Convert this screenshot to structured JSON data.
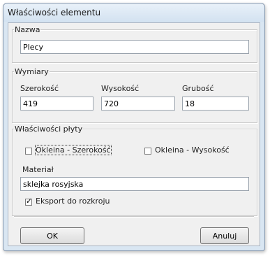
{
  "window": {
    "title": "Właściwości elementu"
  },
  "name_group": {
    "legend": "Nazwa",
    "value": "Plecy"
  },
  "dimensions_group": {
    "legend": "Wymiary",
    "width_label": "Szerokość",
    "height_label": "Wysokość",
    "thickness_label": "Grubość",
    "width_value": "419",
    "height_value": "720",
    "thickness_value": "18"
  },
  "board_group": {
    "legend": "Właściwości płyty",
    "edge_width_label": "Okleina - Szerokość",
    "edge_width_checked": false,
    "edge_height_label": "Okleina - Wysokość",
    "edge_height_checked": false,
    "material_label": "Materiał",
    "material_value": "sklejka rosyjska",
    "export_label": "Eksport do rozkroju",
    "export_checked": true
  },
  "buttons": {
    "ok_label": "OK",
    "cancel_label": "Anuluj"
  }
}
